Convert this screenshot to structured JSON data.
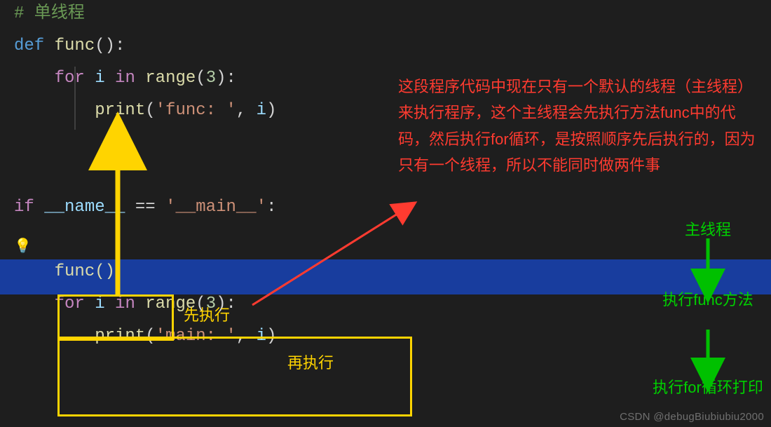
{
  "code": {
    "line1": "# 单线程",
    "line2_def": "def",
    "line2_fn": "func",
    "line2_paren": "():",
    "line3_for": "for",
    "line3_i": "i",
    "line3_in": "in",
    "line3_range": "range",
    "line3_num": "3",
    "line3_close": "):",
    "line4_print": "print",
    "line4_str": "'func: '",
    "line4_i": "i",
    "line6_if": "if",
    "line6_name": "__name__",
    "line6_eq": "==",
    "line6_main": "'__main__'",
    "line6_colon": ":",
    "line8_func": "func()",
    "line9_for": "for",
    "line9_i": "i",
    "line9_in": "in",
    "line9_range": "range",
    "line9_num": "3",
    "line9_close": "):",
    "line10_print": "print",
    "line10_str": "'main: '",
    "line10_i": "i",
    "line10_close": ")"
  },
  "ann": {
    "red_text": "这段程序代码中现在只有一个默认的线程（主线程）来执行程序，这个主线程会先执行方法func中的代码，然后执行for循环，是按照顺序先后执行的，因为只有一个线程，所以不能同时做两件事",
    "first": "先执行",
    "second": "再执行",
    "flow1": "主线程",
    "flow2": "执行func方法",
    "flow3": "执行for循环打印",
    "watermark": "CSDN @debugBiubiubiu2000"
  }
}
